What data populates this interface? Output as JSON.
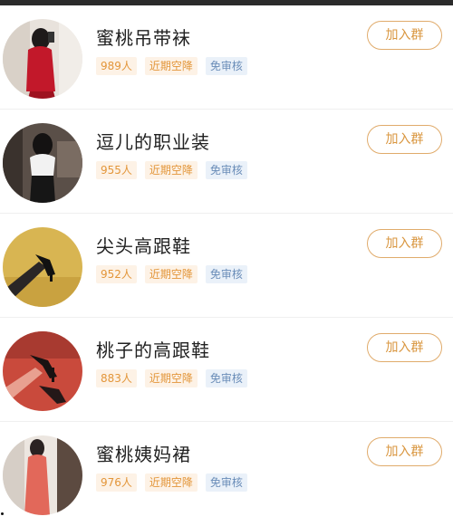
{
  "groups": [
    {
      "title": "蜜桃吊带袜",
      "count": "989人",
      "tag_hot": "近期空降",
      "tag_free": "免审核",
      "button": "加入群"
    },
    {
      "title": "逗儿的职业装",
      "count": "955人",
      "tag_hot": "近期空降",
      "tag_free": "免审核",
      "button": "加入群"
    },
    {
      "title": "尖头高跟鞋",
      "count": "952人",
      "tag_hot": "近期空降",
      "tag_free": "免审核",
      "button": "加入群"
    },
    {
      "title": "桃子的高跟鞋",
      "count": "883人",
      "tag_hot": "近期空降",
      "tag_free": "免审核",
      "button": "加入群"
    },
    {
      "title": "蜜桃姨妈裙",
      "count": "976人",
      "tag_hot": "近期空降",
      "tag_free": "免审核",
      "button": "加入群"
    }
  ],
  "colors": {
    "accent": "#d9963f",
    "tag_warm_bg": "#fdf2e6",
    "tag_cool_bg": "#eaf1f9",
    "tag_cool_text": "#6a8db8"
  },
  "icons": [
    "group-avatar-photo"
  ]
}
